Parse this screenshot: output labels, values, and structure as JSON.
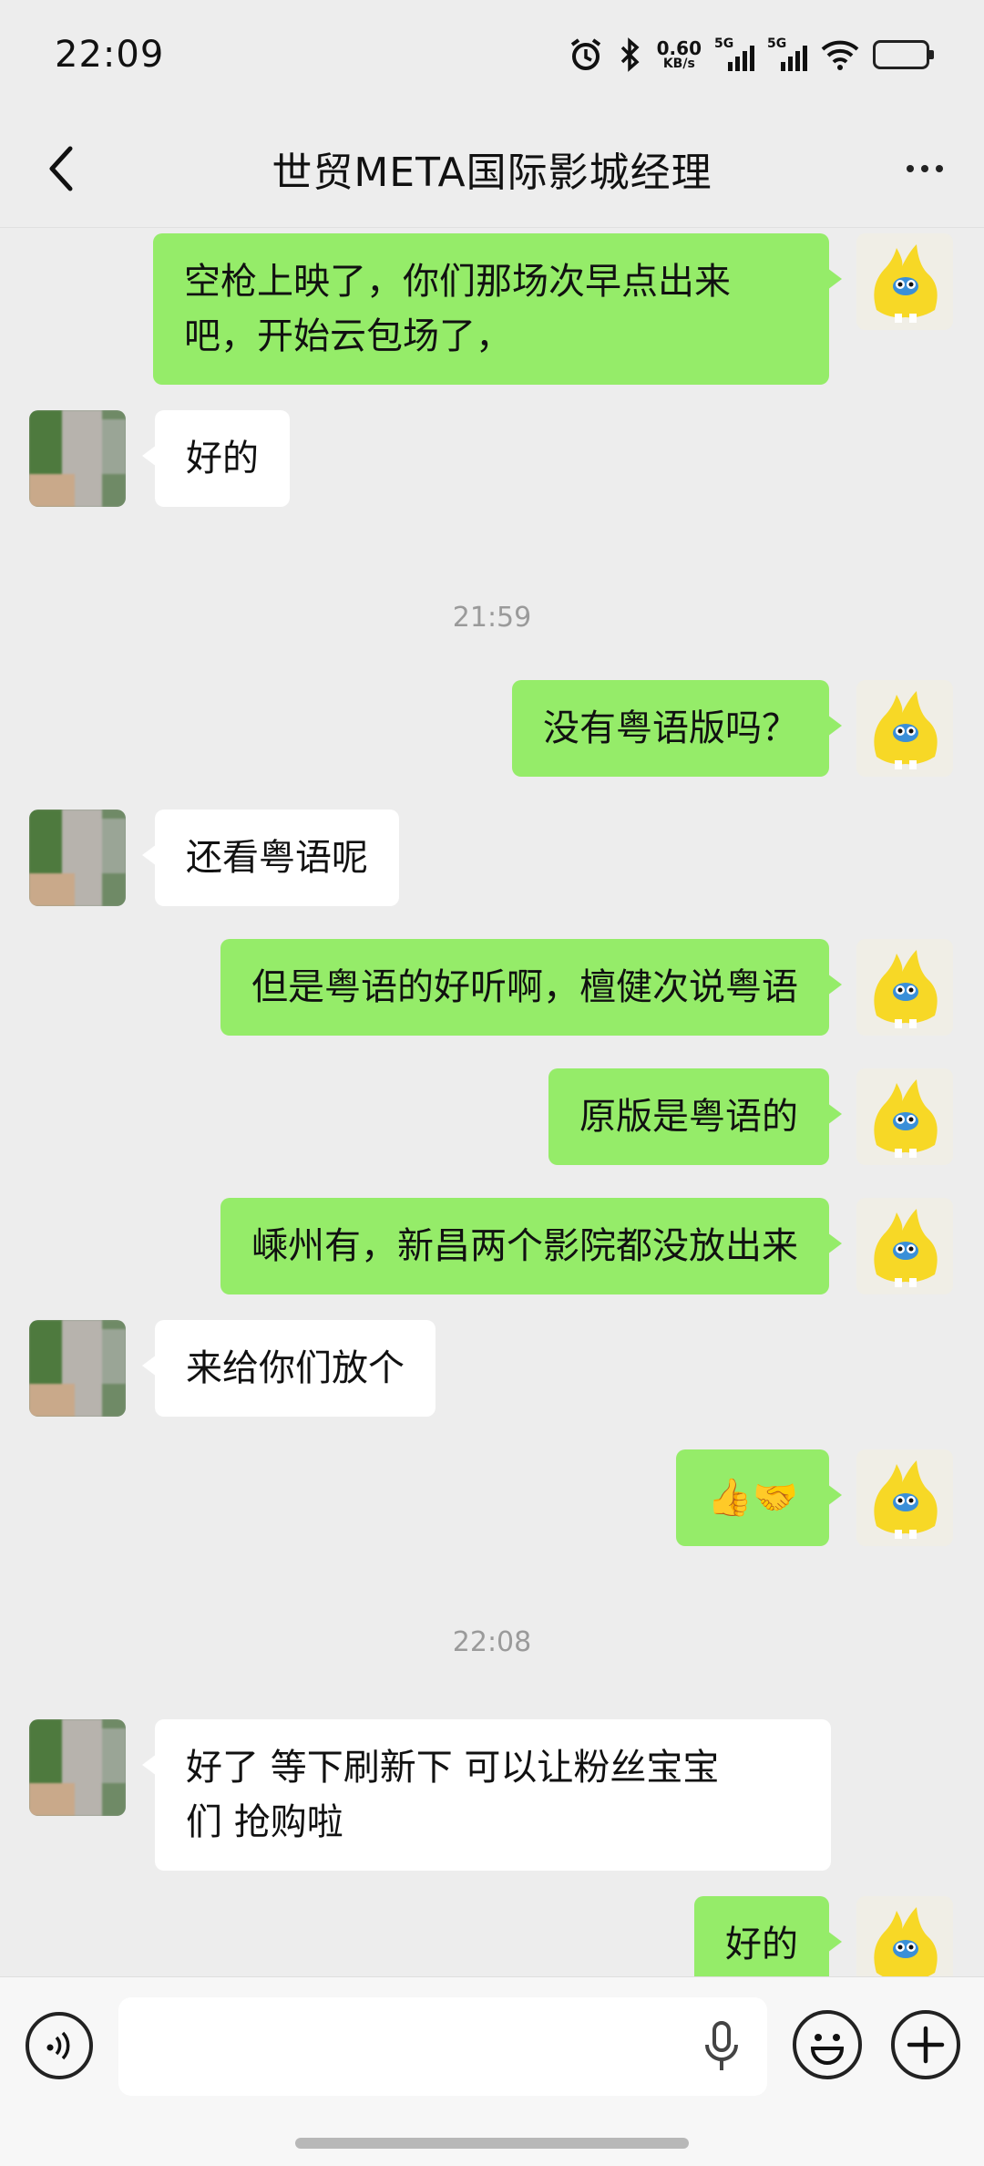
{
  "status_bar": {
    "time": "22:09",
    "net_speed_value": "0.60",
    "net_speed_unit": "KB/s",
    "signal1_label": "5G",
    "signal2_label": "5G",
    "icons": [
      "alarm-icon",
      "bluetooth-icon",
      "signal-icon",
      "signal-icon",
      "wifi-icon",
      "battery-icon"
    ]
  },
  "header": {
    "title": "世贸META国际影城经理",
    "back_icon": "chevron-left-icon",
    "more_icon": "more-dots-icon"
  },
  "chat": {
    "timestamps": [
      "21:59",
      "22:08"
    ],
    "messages": [
      {
        "from": "self",
        "text": "空枪上映了，你们那场次早点出来吧，开始云包场了，",
        "line1": "空枪上映了，你们那场次早点出来",
        "line2": "吧，开始云包场了，"
      },
      {
        "from": "other",
        "text": "好的"
      },
      {
        "from": "self",
        "text": "没有粤语版吗？"
      },
      {
        "from": "other",
        "text": "还看粤语呢"
      },
      {
        "from": "self",
        "text": "但是粤语的好听啊，檀健次说粤语"
      },
      {
        "from": "self",
        "text": "原版是粤语的"
      },
      {
        "from": "self",
        "text": "嵊州有，新昌两个影院都没放出来"
      },
      {
        "from": "other",
        "text": "来给你们放个"
      },
      {
        "from": "self",
        "text": "👍🤝"
      },
      {
        "from": "other",
        "text": "好了 等下刷新下 可以让粉丝宝宝们 抢购啦",
        "line1": "好了 等下刷新下 可以让粉丝宝宝",
        "line2": "们 抢购啦"
      },
      {
        "from": "self",
        "text": "好的"
      }
    ]
  },
  "input_bar": {
    "voice_icon": "voice-mode-icon",
    "mic_icon": "microphone-icon",
    "emoji_icon": "emoji-icon",
    "plus_icon": "plus-icon"
  },
  "colors": {
    "background": "#ededed",
    "self_bubble": "#95ec69",
    "other_bubble": "#ffffff",
    "timestamp": "#9a9a9a"
  }
}
